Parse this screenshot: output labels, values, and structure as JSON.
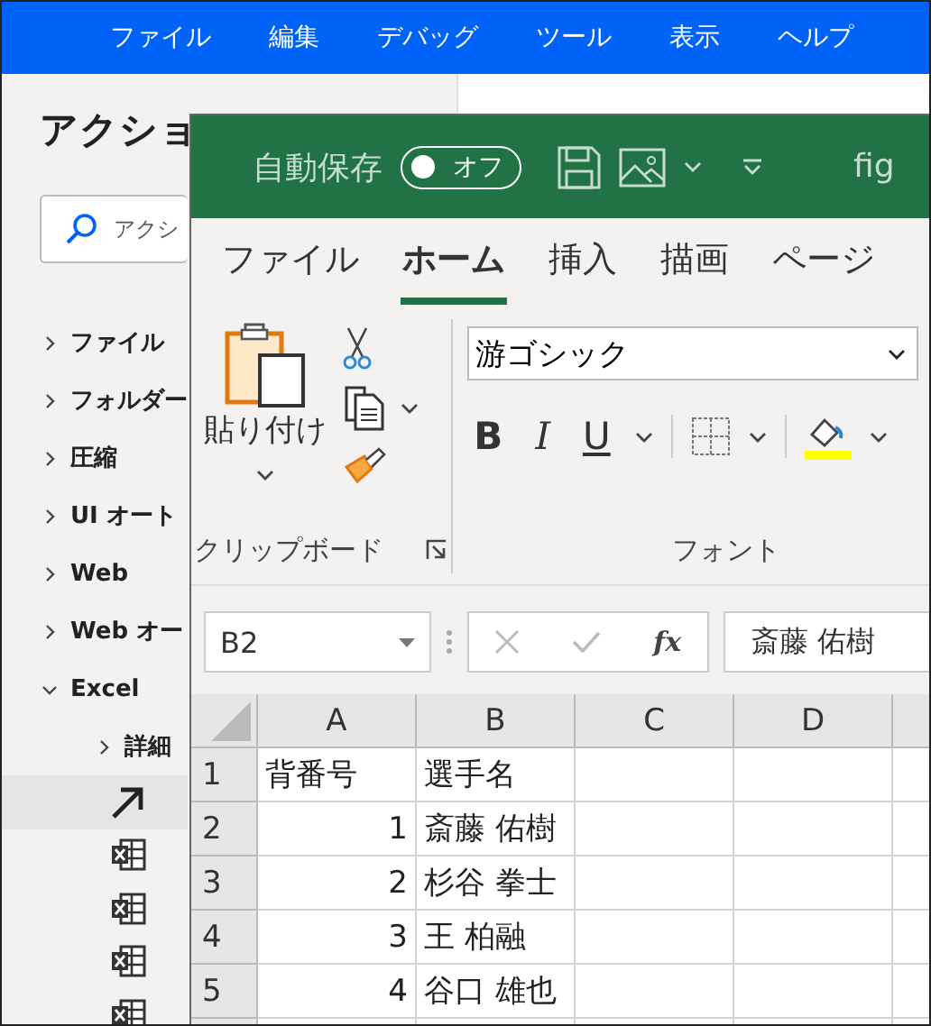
{
  "menu_bar": {
    "items": [
      "ファイル",
      "編集",
      "デバッグ",
      "ツール",
      "表示",
      "ヘルプ"
    ]
  },
  "actions_pane": {
    "title": "アクショ",
    "search": {
      "placeholder": "アクシ"
    },
    "items": [
      {
        "kind": "category",
        "label": "ファイル",
        "expanded": false,
        "selected": false
      },
      {
        "kind": "category",
        "label": "フォルダー",
        "expanded": false,
        "selected": false
      },
      {
        "kind": "category",
        "label": "圧縮",
        "expanded": false,
        "selected": false
      },
      {
        "kind": "category",
        "label": "UI オート",
        "expanded": false,
        "selected": false
      },
      {
        "kind": "category",
        "label": "Web",
        "expanded": false,
        "selected": false
      },
      {
        "kind": "category",
        "label": "Web オー",
        "expanded": false,
        "selected": false
      },
      {
        "kind": "category",
        "label": "Excel",
        "expanded": true,
        "selected": false,
        "children": [
          {
            "kind": "category",
            "label": "詳細",
            "expanded": false,
            "selected": false
          },
          {
            "kind": "launch",
            "selected": true
          },
          {
            "kind": "excel",
            "selected": false
          },
          {
            "kind": "excel",
            "selected": false
          },
          {
            "kind": "excel",
            "selected": false
          },
          {
            "kind": "excel",
            "selected": false
          }
        ]
      }
    ]
  },
  "excel": {
    "title_bar": {
      "autosave_label": "自動保存",
      "autosave": {
        "label": "オフ",
        "on": false
      },
      "file_name": "fig"
    },
    "tabs": [
      {
        "label": "ファイル",
        "selected": false
      },
      {
        "label": "ホーム",
        "selected": true
      },
      {
        "label": "挿入",
        "selected": false
      },
      {
        "label": "描画",
        "selected": false
      },
      {
        "label": "ページ",
        "selected": false
      }
    ],
    "ribbon": {
      "clipboard": {
        "paste_label": "貼り付け",
        "group_label": "クリップボード"
      },
      "font": {
        "font_name": "游ゴシック",
        "bold": "B",
        "italic": "I",
        "underline": "U",
        "group_label": "フォント"
      }
    },
    "formula_bar": {
      "name_box": "B2",
      "fx": "fx",
      "value": "斎藤 佑樹"
    },
    "sheet": {
      "columns": [
        "A",
        "B",
        "C",
        "D"
      ],
      "rows": [
        {
          "header": "1",
          "cells": [
            {
              "value": "背番号",
              "kind": "text"
            },
            {
              "value": "選手名",
              "kind": "text"
            }
          ]
        },
        {
          "header": "2",
          "cells": [
            {
              "value": "1",
              "kind": "number"
            },
            {
              "value": "斎藤 佑樹",
              "kind": "text"
            }
          ]
        },
        {
          "header": "3",
          "cells": [
            {
              "value": "2",
              "kind": "number"
            },
            {
              "value": "杉谷 拳士",
              "kind": "text"
            }
          ]
        },
        {
          "header": "4",
          "cells": [
            {
              "value": "3",
              "kind": "number"
            },
            {
              "value": "王 柏融",
              "kind": "text"
            }
          ]
        },
        {
          "header": "5",
          "cells": [
            {
              "value": "4",
              "kind": "number"
            },
            {
              "value": "谷口 雄也",
              "kind": "text"
            }
          ]
        }
      ]
    }
  }
}
